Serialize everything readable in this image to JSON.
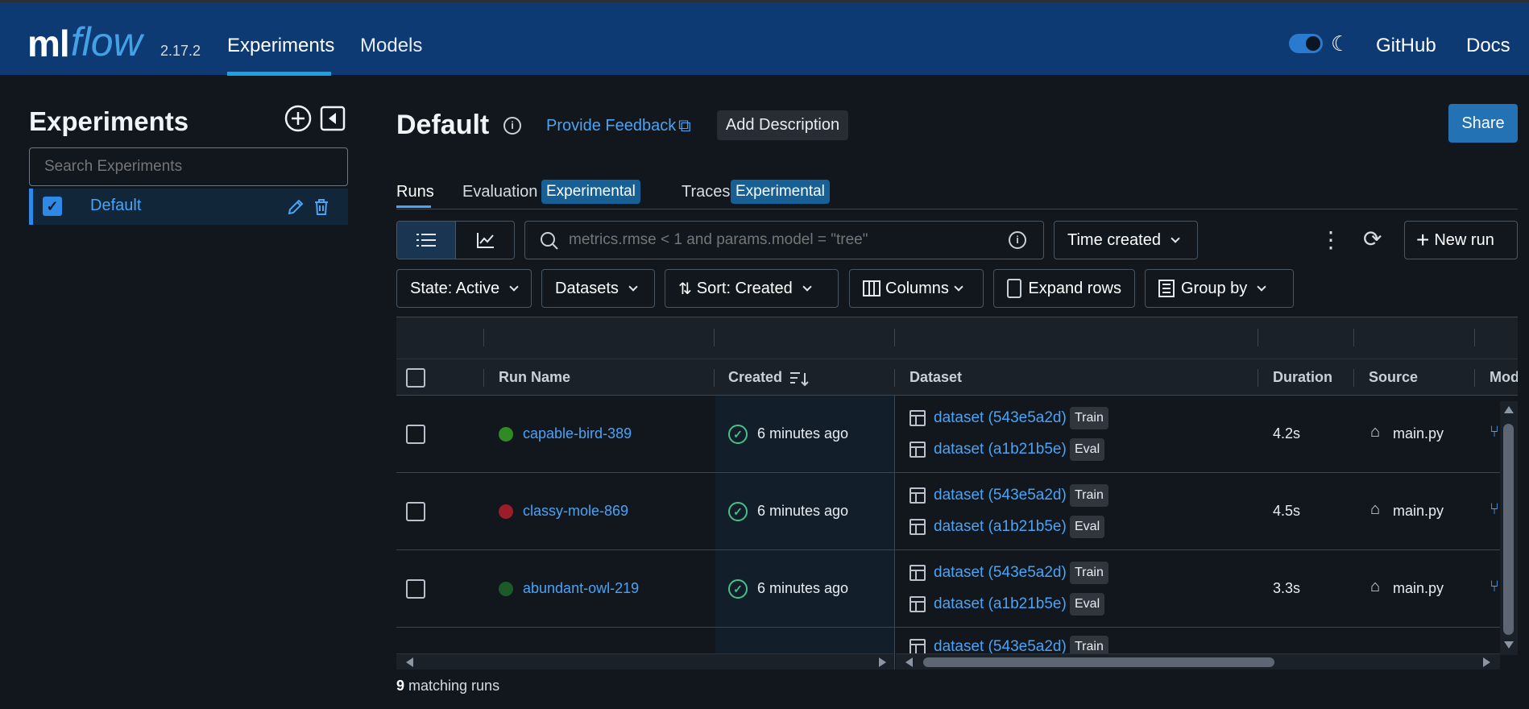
{
  "header": {
    "logo_ml": "ml",
    "logo_flow": "flow",
    "version": "2.17.2",
    "nav": [
      "Experiments",
      "Models"
    ],
    "github": "GitHub",
    "docs": "Docs",
    "theme_toggle_on": true
  },
  "sidebar": {
    "title": "Experiments",
    "search_placeholder": "Search Experiments",
    "experiments": [
      {
        "name": "Default",
        "checked": true
      }
    ]
  },
  "main": {
    "title": "Default",
    "feedback_link": "Provide Feedback",
    "add_description": "Add Description",
    "share": "Share",
    "tabs": [
      {
        "label": "Runs",
        "badge": ""
      },
      {
        "label": "Evaluation",
        "badge": "Experimental"
      },
      {
        "label": "Traces",
        "badge": "Experimental"
      }
    ],
    "filter_placeholder": "metrics.rmse < 1 and params.model = \"tree\"",
    "time_created": "Time created",
    "new_run": "New run",
    "controls": {
      "state": "State: Active",
      "datasets": "Datasets",
      "sort": "Sort: Created",
      "columns": "Columns",
      "expand_rows": "Expand rows",
      "group_by": "Group by"
    }
  },
  "table": {
    "columns": [
      "Run Name",
      "Created",
      "Dataset",
      "Duration",
      "Source",
      "Mod"
    ],
    "rows": [
      {
        "name": "capable-bird-389",
        "status_color": "#2f8a22",
        "created": "6 minutes ago",
        "ds1": "dataset (543e5a2d)",
        "tag1": "Train",
        "ds2": "dataset (a1b21b5e)",
        "tag2": "Eval",
        "duration": "4.2s",
        "source": "main.py"
      },
      {
        "name": "classy-mole-869",
        "status_color": "#9b1d2a",
        "created": "6 minutes ago",
        "ds1": "dataset (543e5a2d)",
        "tag1": "Train",
        "ds2": "dataset (a1b21b5e)",
        "tag2": "Eval",
        "duration": "4.5s",
        "source": "main.py"
      },
      {
        "name": "abundant-owl-219",
        "status_color": "#1d5a2a",
        "created": "6 minutes ago",
        "ds1": "dataset (543e5a2d)",
        "tag1": "Train",
        "ds2": "dataset (a1b21b5e)",
        "tag2": "Eval",
        "duration": "3.3s",
        "source": "main.py"
      },
      {
        "partial_ds": "dataset (543e5a2d)",
        "partial_tag": "Train"
      }
    ],
    "matching_count": "9",
    "matching_label": " matching runs"
  }
}
